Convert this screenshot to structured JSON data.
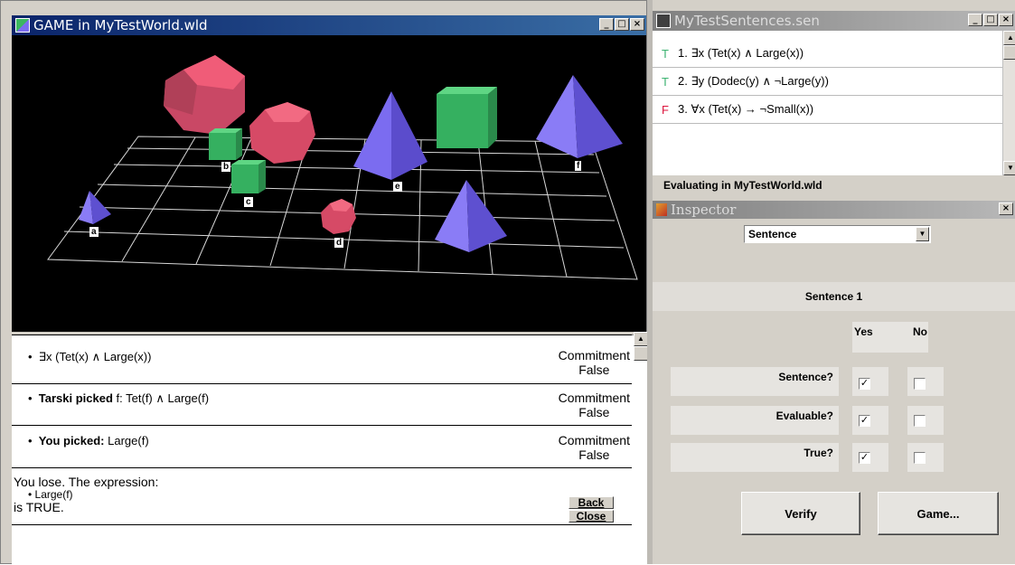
{
  "game_window": {
    "title": "GAME in MyTestWorld.wld",
    "win_buttons": [
      "_",
      "□",
      "×"
    ],
    "world_labels": [
      "a",
      "b",
      "c",
      "d",
      "e",
      "f"
    ],
    "rows": [
      {
        "bullet": "•",
        "bold": "",
        "text": "∃x (Tet(x) ∧ Large(x))",
        "commit_label": "Commitment",
        "commit_value": "False"
      },
      {
        "bullet": "•",
        "bold": "Tarski picked",
        "text": " f:  Tet(f) ∧ Large(f)",
        "commit_label": "Commitment",
        "commit_value": "False"
      },
      {
        "bullet": "•",
        "bold": "You picked:",
        "text": "  Large(f)",
        "commit_label": "Commitment",
        "commit_value": "False"
      }
    ],
    "result": {
      "line1": "You lose.  The expression:",
      "line2": "• Large(f)",
      "line3": "is TRUE."
    },
    "back_label": "Back",
    "close_label": "Close"
  },
  "sentences_window": {
    "title": "MyTestSentences.sen",
    "win_buttons": [
      "_",
      "□",
      "×"
    ],
    "sentences": [
      {
        "truth": "T",
        "truth_color": "#3cb371",
        "text": "1. ∃x (Tet(x) ∧ Large(x))"
      },
      {
        "truth": "T",
        "truth_color": "#3cb371",
        "text": "2. ∃y (Dodec(y) ∧ ¬Large(y))"
      },
      {
        "truth": "F",
        "truth_color": "#dc143c",
        "text": "3. ∀x (Tet(x) → ¬Small(x))"
      }
    ],
    "status": "Evaluating in MyTestWorld.wld"
  },
  "inspector": {
    "title": "Inspector",
    "close": "×",
    "dropdown_value": "Sentence",
    "section_label": "Sentence 1",
    "yes_label": "Yes",
    "no_label": "No",
    "questions": [
      {
        "label": "Sentence?",
        "yes": true,
        "no": false
      },
      {
        "label": "Evaluable?",
        "yes": true,
        "no": false
      },
      {
        "label": "True?",
        "yes": true,
        "no": false
      }
    ],
    "verify_label": "Verify",
    "game_label": "Game..."
  },
  "colors": {
    "tet": "#7b6cf0",
    "cube": "#3cb660",
    "dodec": "#e0506a"
  }
}
